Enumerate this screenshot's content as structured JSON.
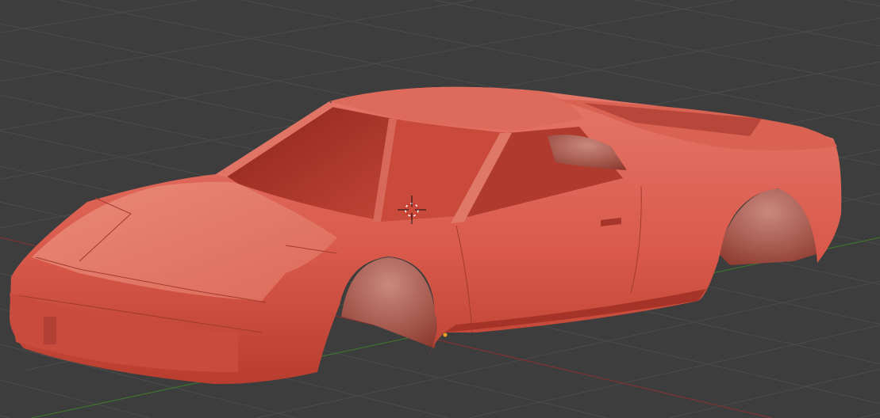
{
  "viewport": {
    "view": "3d-viewport",
    "object": "car-body",
    "colors": {
      "background": "#3d3d3d",
      "grid": "#4b4b4b",
      "x_axis": "#8a2e2e",
      "y_axis": "#3f7a2a",
      "body": "#d9584a",
      "body_highlight": "#e8806f",
      "body_shadow": "#a93528",
      "interior": "#9a2a1f",
      "cursor_outer": "#ffffff",
      "cursor_inner": "#d0302a"
    }
  }
}
